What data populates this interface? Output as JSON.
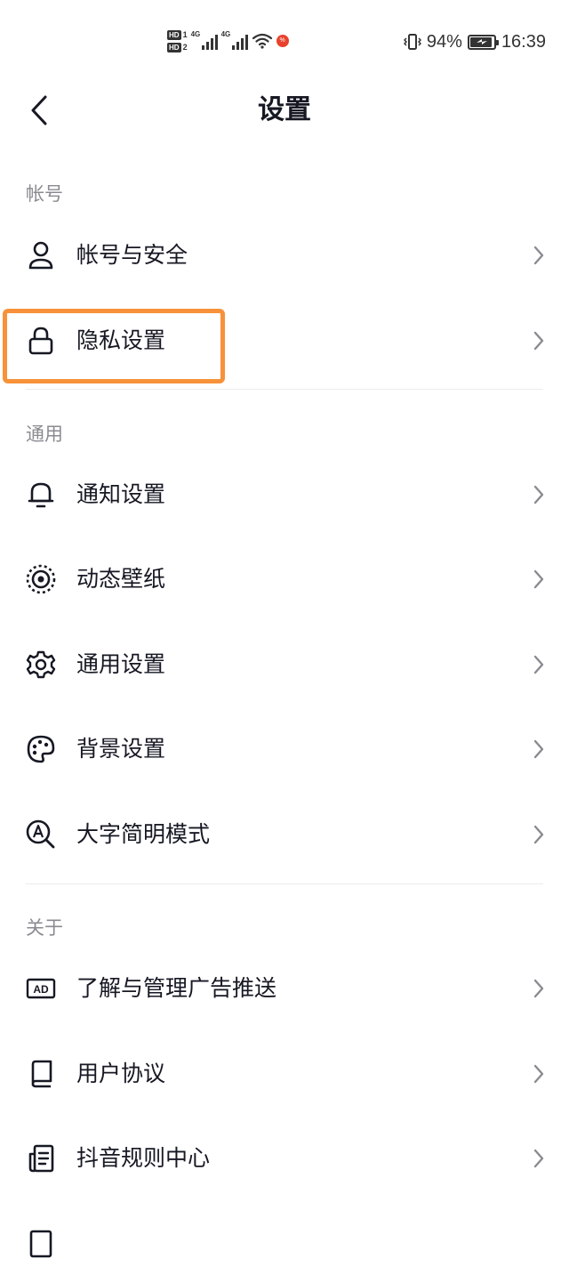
{
  "status_bar": {
    "sim1": "1",
    "sim2": "2",
    "hd": "HD",
    "network1": "4G",
    "network2": "4G",
    "battery_percent": "94%",
    "battery_level": 0.94,
    "time": "16:39",
    "notif_badge": "%"
  },
  "header": {
    "title": "设置"
  },
  "sections": [
    {
      "label": "帐号",
      "items": [
        {
          "label": "帐号与安全",
          "icon": "user-icon"
        },
        {
          "label": "隐私设置",
          "icon": "lock-icon"
        }
      ]
    },
    {
      "label": "通用",
      "items": [
        {
          "label": "通知设置",
          "icon": "bell-icon"
        },
        {
          "label": "动态壁纸",
          "icon": "live-wallpaper-icon"
        },
        {
          "label": "通用设置",
          "icon": "gear-icon"
        },
        {
          "label": "背景设置",
          "icon": "palette-icon"
        },
        {
          "label": "大字简明模式",
          "icon": "large-text-search-icon"
        }
      ]
    },
    {
      "label": "关于",
      "items": [
        {
          "label": "了解与管理广告推送",
          "icon": "ad-icon",
          "icon_text": "AD"
        },
        {
          "label": "用户协议",
          "icon": "book-icon"
        },
        {
          "label": "抖音规则中心",
          "icon": "document-icon"
        }
      ]
    }
  ],
  "colors": {
    "text": "#161823",
    "section_label": "#8a8b91",
    "divider": "#ececee",
    "chevron": "#8a8b91",
    "highlight": "#f7923a"
  }
}
